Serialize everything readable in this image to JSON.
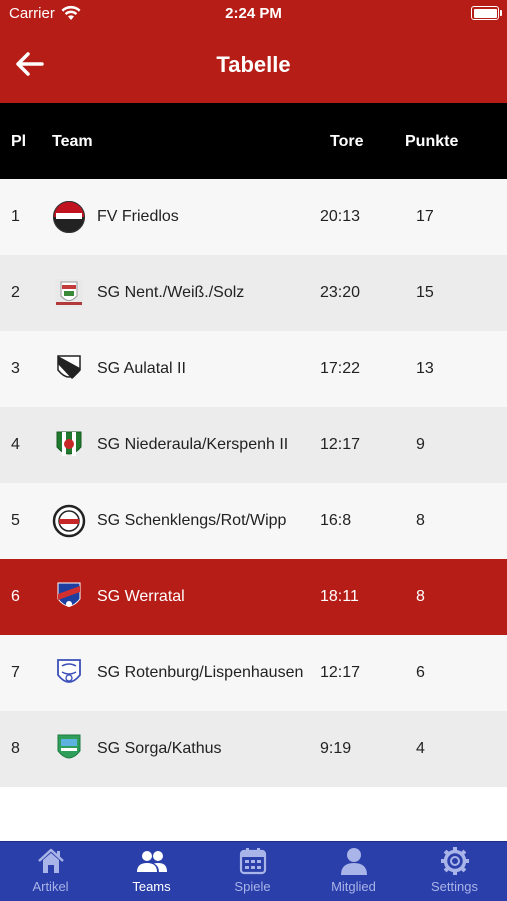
{
  "status": {
    "carrier": "Carrier",
    "time": "2:24 PM"
  },
  "header": {
    "title": "Tabelle"
  },
  "table": {
    "columns": {
      "pl": "Pl",
      "team": "Team",
      "tore": "Tore",
      "punkte": "Punkte"
    },
    "rows": [
      {
        "pl": "1",
        "team": "FV Friedlos",
        "tore": "20:13",
        "punkte": "17"
      },
      {
        "pl": "2",
        "team": "SG Nent./Weiß./Solz",
        "tore": "23:20",
        "punkte": "15"
      },
      {
        "pl": "3",
        "team": "SG Aulatal II",
        "tore": "17:22",
        "punkte": "13"
      },
      {
        "pl": "4",
        "team": "SG Niederaula/Kerspenh II",
        "tore": "12:17",
        "punkte": "9"
      },
      {
        "pl": "5",
        "team": "SG Schenklengs/Rot/Wipp",
        "tore": "16:8",
        "punkte": "8"
      },
      {
        "pl": "6",
        "team": "SG Werratal",
        "tore": "18:11",
        "punkte": "8"
      },
      {
        "pl": "7",
        "team": "SG Rotenburg/Lispenhausen",
        "tore": "12:17",
        "punkte": "6"
      },
      {
        "pl": "8",
        "team": "SG Sorga/Kathus",
        "tore": "9:19",
        "punkte": "4"
      }
    ]
  },
  "tabbar": {
    "tabs": [
      {
        "label": "Artikel",
        "icon": "home-icon"
      },
      {
        "label": "Teams",
        "icon": "people-icon"
      },
      {
        "label": "Spiele",
        "icon": "calendar-icon"
      },
      {
        "label": "Mitglied",
        "icon": "person-icon"
      },
      {
        "label": "Settings",
        "icon": "gear-icon"
      }
    ]
  },
  "colors": {
    "header": "#b71d17",
    "highlight": "#b71d17",
    "tabbar": "#2a3faa",
    "table_header": "#000000"
  }
}
